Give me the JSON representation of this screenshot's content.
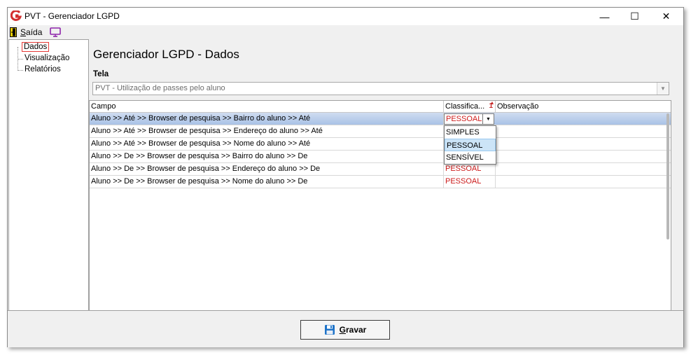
{
  "window": {
    "title": "PVT - Gerenciador LGPD"
  },
  "titlebar_buttons": {
    "minimize": "—",
    "maximize": "☐",
    "close": "✕"
  },
  "menu": {
    "exit_first": "S",
    "exit_rest": "aída"
  },
  "tree": {
    "items": [
      {
        "label": "Dados",
        "selected": true
      },
      {
        "label": "Visualização"
      },
      {
        "label": "Relatórios"
      }
    ]
  },
  "main": {
    "title": "Gerenciador LGPD - Dados",
    "tela_label": "Tela",
    "tela_value": "PVT - Utilização de passes pelo aluno"
  },
  "grid": {
    "columns": [
      "Campo",
      "Classifica...",
      "Observação"
    ],
    "sort_indicator": "1",
    "rows": [
      {
        "campo": "Aluno >> Até >> Browser de pesquisa >> Bairro do aluno >> Até",
        "classificacao": "PESSOAL",
        "observacao": ""
      },
      {
        "campo": "Aluno >> Até >> Browser de pesquisa >> Endereço do aluno >> Até",
        "classificacao": "",
        "observacao": ""
      },
      {
        "campo": "Aluno >> Até >> Browser de pesquisa >> Nome do aluno >> Até",
        "classificacao": "",
        "observacao": ""
      },
      {
        "campo": "Aluno >> De >> Browser de pesquisa >> Bairro do aluno >> De",
        "classificacao": "",
        "observacao": ""
      },
      {
        "campo": "Aluno >> De >> Browser de pesquisa >> Endereço do aluno >> De",
        "classificacao": "PESSOAL",
        "observacao": ""
      },
      {
        "campo": "Aluno >> De >> Browser de pesquisa >> Nome do aluno >> De",
        "classificacao": "PESSOAL",
        "observacao": ""
      }
    ],
    "dropdown_options": [
      "SIMPLES",
      "PESSOAL",
      "SENSÍVEL"
    ],
    "dropdown_selected": "PESSOAL"
  },
  "footer": {
    "save_first": "G",
    "save_rest": "ravar"
  },
  "colors": {
    "accent_red": "#cc1a1a",
    "selection_blue": "#a9c2e6",
    "app_logo_red": "#d32f2f",
    "monitor_purple": "#8e24aa"
  },
  "icons": {
    "app": "app-logo-icon",
    "exit": "exit-door-icon",
    "monitor": "monitor-icon",
    "save": "floppy-disk-icon"
  }
}
